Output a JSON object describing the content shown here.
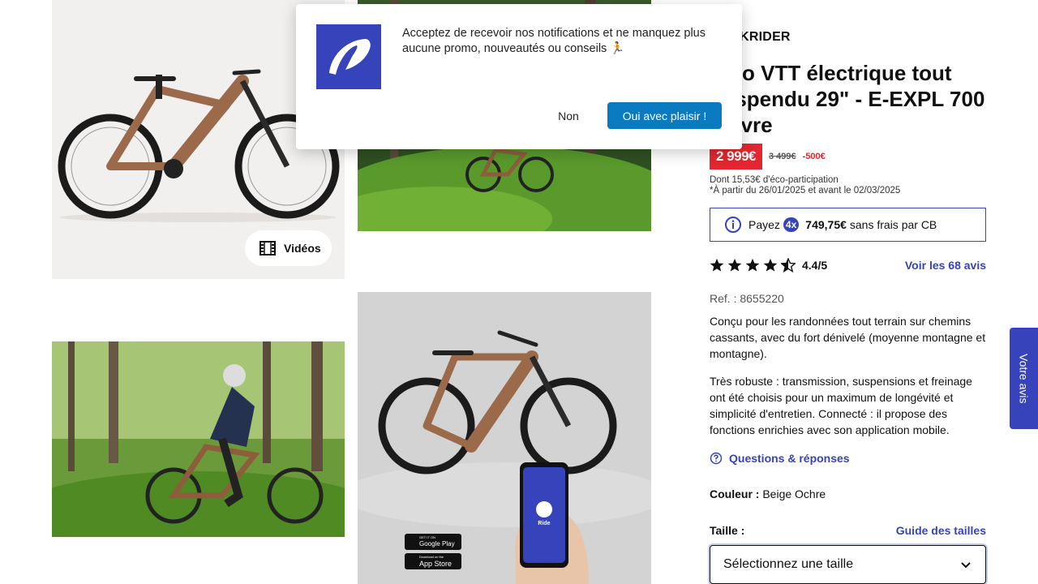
{
  "gallery": {
    "videos_label": "Vidéos"
  },
  "product": {
    "brand": "ROCKRIDER",
    "title": "Vélo VTT électrique tout suspendu 29\" - E-EXPL 700 cuivre",
    "price": "2 999€",
    "old_price": "3 499€",
    "discount": "-500€",
    "eco_line": "Dont 15,53€ d'éco-participation",
    "promo_line": "*À partir du 26/01/2025 et avant le 02/03/2025",
    "payment": {
      "prefix": "Payez",
      "badge": "4x",
      "amount": "749,75€",
      "suffix": "sans frais par CB"
    },
    "rating": {
      "value": 4.4,
      "score_text": "4.4/5",
      "reviews_link": "Voir les 68 avis"
    },
    "ref": "Ref. : 8655220",
    "description_1": "Conçu pour les randonnées tout terrain sur chemins cassants, avec du fort dénivelé (moyenne montagne et montagne).",
    "description_2": "Très robuste : transmission, suspensions et freinage ont été choisis pour un maximum de longévité et simplicité d'entretien. Connecté : il propose des fonctions enrichies avec son application mobile.",
    "qa_link": "Questions & réponses",
    "color_label": "Couleur :",
    "color_value": "Beige Ochre",
    "size_label": "Taille :",
    "size_guide": "Guide des tailles",
    "size_select": "Sélectionnez une taille"
  },
  "feedback_tab": "Votre avis",
  "notification": {
    "text": "Acceptez de recevoir nos notifications et ne manquez plus aucune promo, nouveautés ou conseils 🏃",
    "decline": "Non",
    "accept": "Oui avec plaisir !"
  },
  "phone_screen_label": "Ride",
  "store_badges": {
    "google_top": "GET IT ON",
    "google": "Google Play",
    "apple_top": "Download on the",
    "apple": "App Store"
  },
  "colors": {
    "brand_blue": "#3643ba",
    "price_red": "#e3262f",
    "accept_blue": "#0b7bc1"
  }
}
